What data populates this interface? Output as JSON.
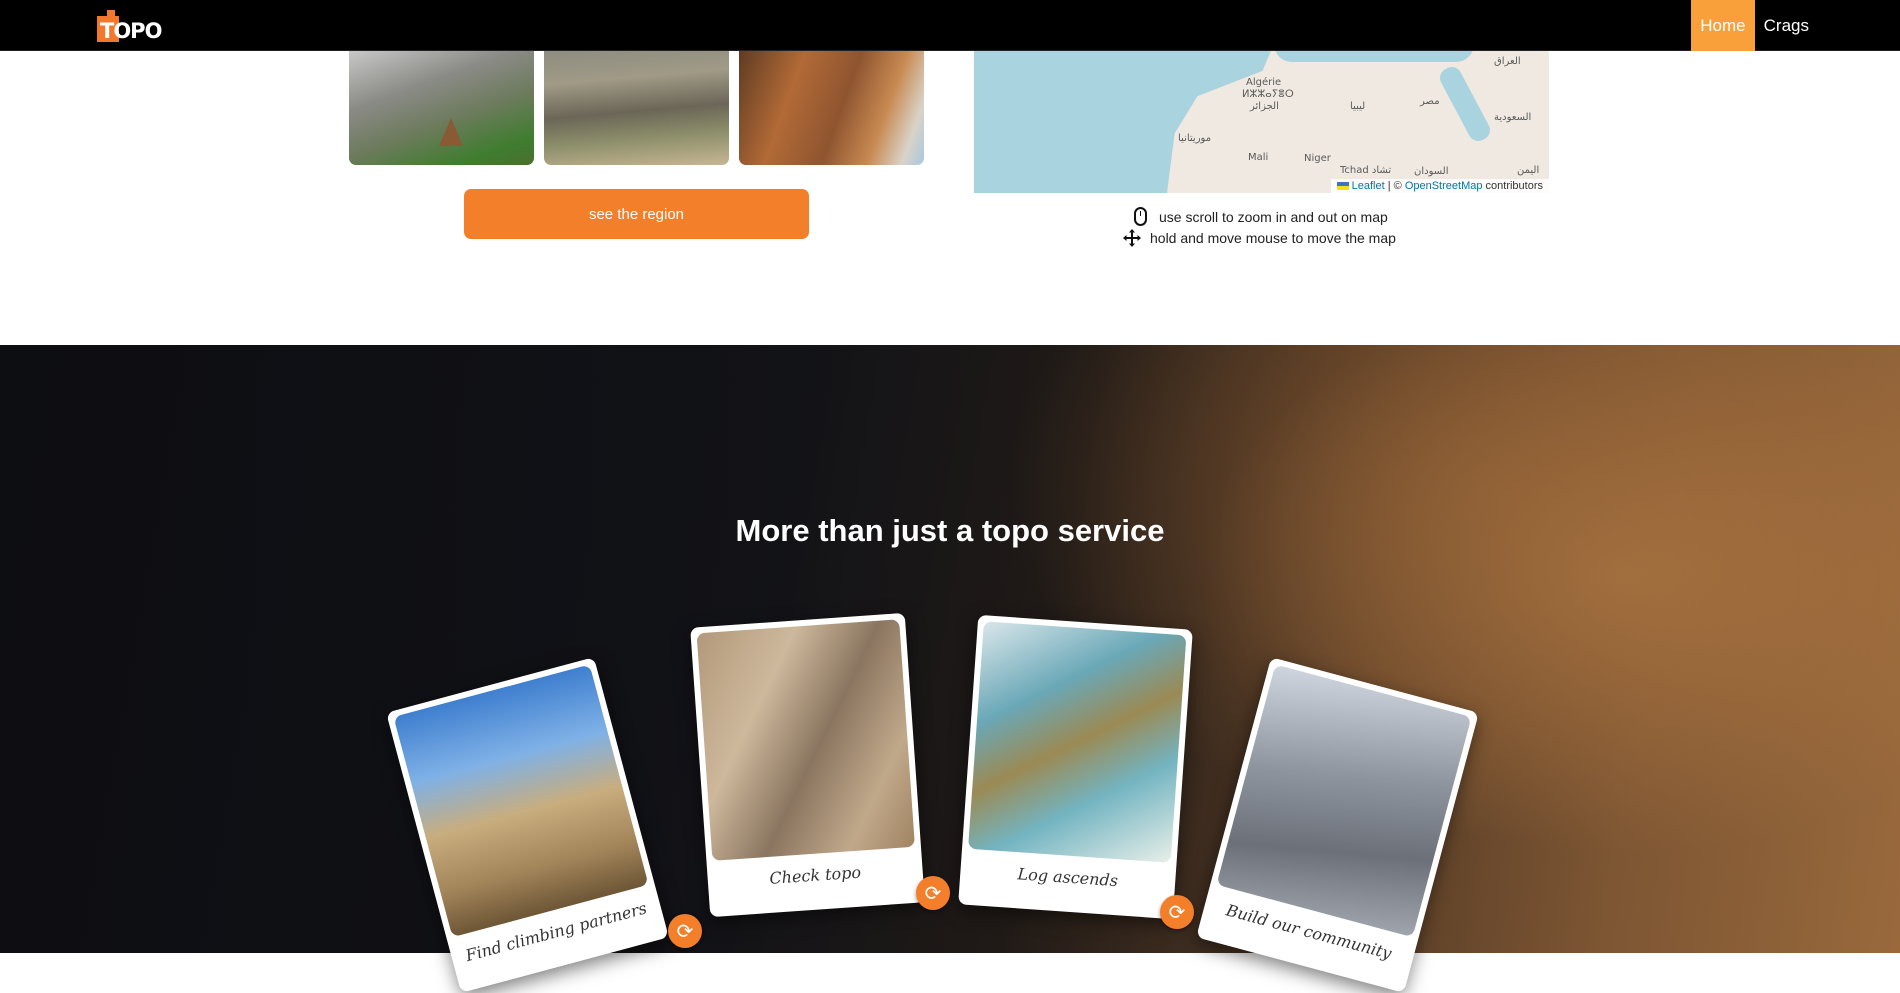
{
  "nav": {
    "logo_text": "TOPO",
    "items": [
      {
        "label": "Home",
        "active": true
      },
      {
        "label": "Crags",
        "active": false
      }
    ]
  },
  "region": {
    "button_label": "see the region"
  },
  "map": {
    "labels": {
      "algeria": "Algérie",
      "algeria_tifinagh": "ⵍⵣⵣⴰⵢⴻⵔ",
      "algeria_ar": "الجزائر",
      "mauritania": "موريتانيا",
      "mali": "Mali",
      "niger": "Niger",
      "chad": "Tchad تشاد",
      "libya": "ليبيا",
      "egypt": "مصر",
      "iraq": "العراق",
      "saudi": "السعودية",
      "sudan": "السودان",
      "yemen": "اليمن"
    },
    "attribution": {
      "leaflet": "Leaflet",
      "separator": " | © ",
      "osm": "OpenStreetMap",
      "contributors": " contributors"
    },
    "hints": {
      "zoom": "use scroll to zoom in and out on map",
      "move": "hold and move mouse to move the map"
    }
  },
  "features": {
    "title": "More than just a topo service",
    "cards": [
      {
        "label": "Find climbing partners",
        "icon": "refresh-icon"
      },
      {
        "label": "Check topo",
        "icon": "refresh-icon"
      },
      {
        "label": "Log ascends",
        "icon": "refresh-icon"
      },
      {
        "label": "Build our community",
        "icon": "refresh-icon"
      }
    ]
  },
  "colors": {
    "accent": "#f47f2b",
    "nav_active": "#f9a03a",
    "nav_bg": "#000000"
  }
}
